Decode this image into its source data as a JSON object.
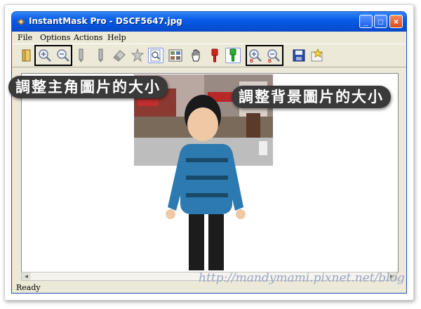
{
  "window": {
    "title": "InstantMask Pro - DSCF5647.jpg",
    "controls": {
      "minimize": "_",
      "maximize": "□",
      "close": "×"
    }
  },
  "menu": [
    "File",
    "Options",
    "Actions",
    "Help"
  ],
  "toolbar": {
    "tools": [
      "open-icon",
      "zoom-in-icon",
      "zoom-out-icon",
      "pencil-icon",
      "pencil-icon",
      "eraser-icon",
      "magic-wand-icon",
      "preview-icon",
      "grid-icon",
      "hand-icon",
      "red-marker-icon",
      "green-marker-icon",
      "bg-zoom-in-icon",
      "bg-zoom-out-icon",
      "save-icon",
      "export-icon"
    ]
  },
  "callouts": {
    "subject_zoom": "調整主角圖片的大小",
    "background_zoom": "調整背景圖片的大小"
  },
  "status": {
    "text": "Ready"
  },
  "watermark": "http://mandymami.pixnet.net/blog",
  "colors": {
    "title_bar": "#0a5ce8",
    "callout": "#3a3a3a",
    "highlight": "#000000"
  }
}
